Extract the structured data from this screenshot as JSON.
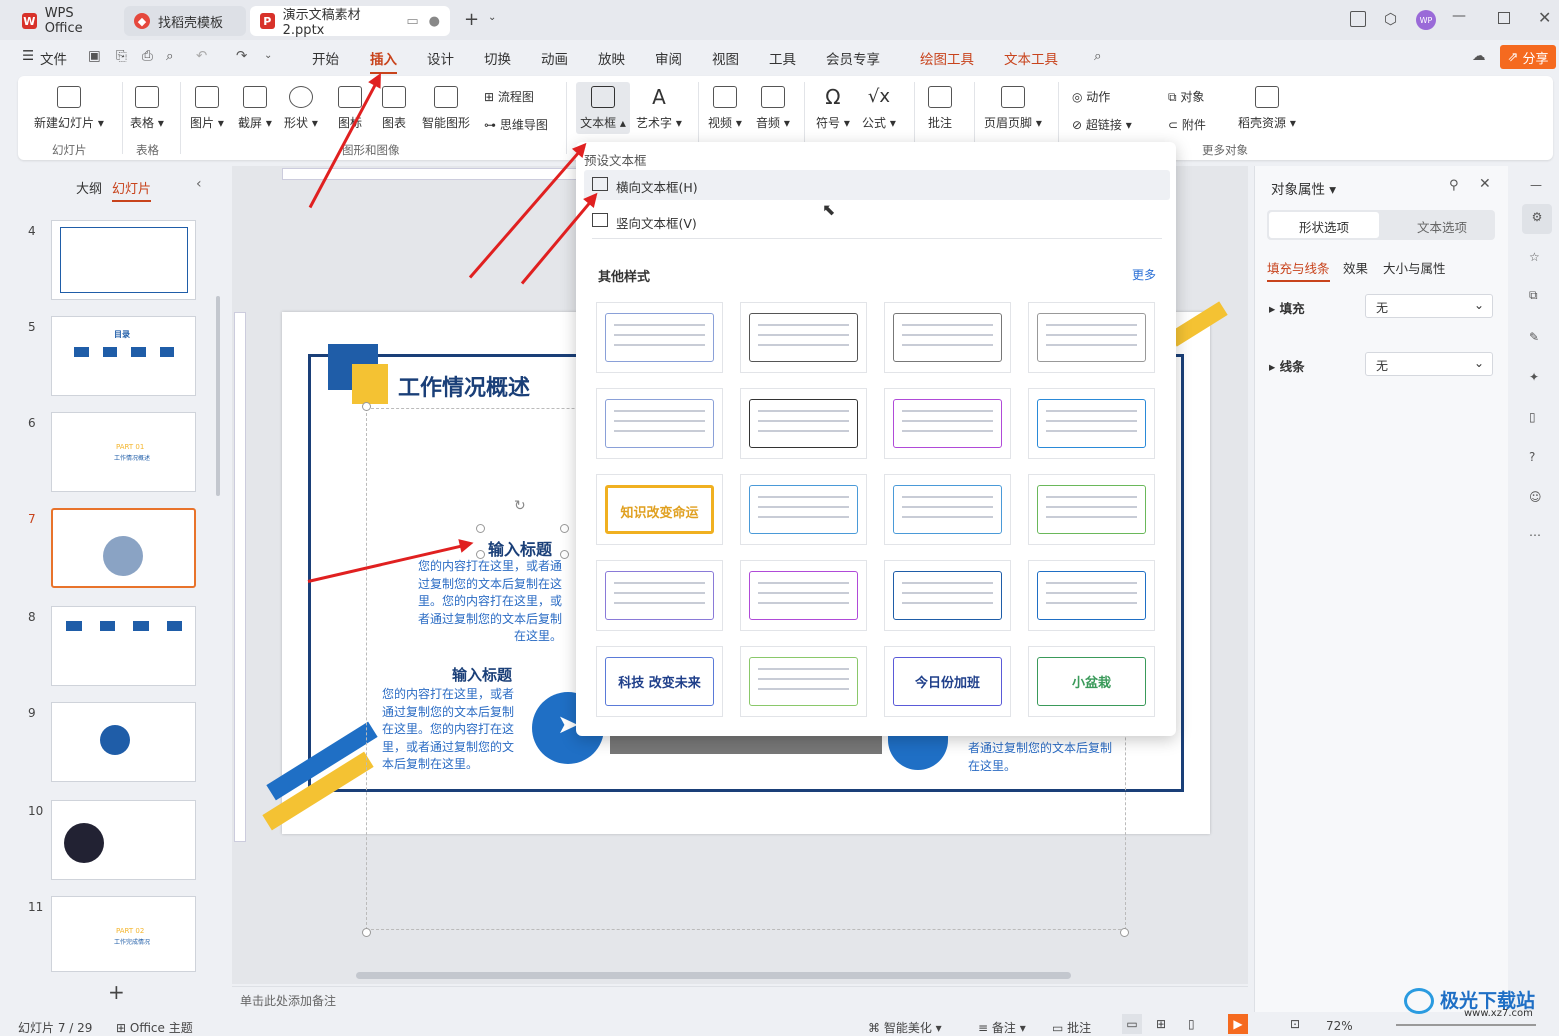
{
  "tabs": [
    {
      "label": "WPS Office"
    },
    {
      "label": "找稻壳模板"
    },
    {
      "label": "演示文稿素材2.pptx"
    }
  ],
  "menu": {
    "file": "文件",
    "items": [
      "开始",
      "插入",
      "设计",
      "切换",
      "动画",
      "放映",
      "审阅",
      "视图",
      "工具",
      "会员专享",
      "绘图工具",
      "文本工具"
    ],
    "share": "分享"
  },
  "ribbon": {
    "new_slide": "新建幻灯片",
    "table": "表格",
    "picture": "图片",
    "screenshot": "截屏",
    "shape": "形状",
    "icons": "图标",
    "chart": "图表",
    "smart": "智能图形",
    "flowchart": "流程图",
    "mindmap": "思维导图",
    "textbox": "文本框",
    "wordart": "艺术字",
    "video": "视频",
    "audio": "音频",
    "symbol": "符号",
    "formula": "公式",
    "comment": "批注",
    "header_footer": "页眉页脚",
    "action": "动作",
    "hyperlink": "超链接",
    "object": "对象",
    "attachment": "附件",
    "docer": "稻壳资源",
    "group_slides": "幻灯片",
    "group_table": "表格",
    "group_graphics": "图形和图像",
    "group_more": "更多对象"
  },
  "left_panel": {
    "outline_tab": "大纲",
    "slides_tab": "幻灯片",
    "slide_numbers": [
      "4",
      "5",
      "6",
      "7",
      "8",
      "9",
      "10",
      "11"
    ],
    "add": "+",
    "thumb_texts": {
      "t5": "目录",
      "t6a": "PART 01",
      "t6b": "工作情况概述",
      "t11a": "PART 02",
      "t11b": "工作完成情况"
    }
  },
  "slide": {
    "title": "工作情况概述",
    "heading1": "输入标题",
    "body1": "您的内容打在这里，或者通过复制您的文本后复制在这里。您的内容打在这里，或者通过复制您的文本后复制在这里。",
    "heading2": "输入标题",
    "body2": "您的内容打在这里，或者通过复制您的文本后复制在这里。您的内容打在这里，或者通过复制您的文本后复制在这里。",
    "body3": "者通过复制您的文本后复制在这里。"
  },
  "dropdown": {
    "preset_title": "预设文本框",
    "horizontal": "横向文本框(H)",
    "vertical": "竖向文本框(V)",
    "other_title": "其他样式",
    "more": "更多",
    "style_texts": [
      "",
      "",
      "",
      "",
      "",
      "",
      "",
      "",
      "",
      "",
      "",
      "",
      "",
      "",
      "",
      "",
      "科技 改变未来",
      "",
      "今日份加班",
      "小盆栽"
    ],
    "style_bold_texts": [
      "",
      "",
      "",
      "",
      "",
      "",
      "",
      "",
      "知识改变命运",
      "",
      "",
      "",
      "",
      "",
      "",
      "",
      "",
      "",
      "",
      ""
    ]
  },
  "right_panel": {
    "title": "对象属性",
    "tab_shape": "形状选项",
    "tab_text": "文本选项",
    "sub_fill": "填充与线条",
    "sub_effect": "效果",
    "sub_size": "大小与属性",
    "fill_label": "填充",
    "fill_value": "无",
    "line_label": "线条",
    "line_value": "无"
  },
  "notes": "单击此处添加备注",
  "status": {
    "slide": "幻灯片 7 / 29",
    "theme": "Office 主题",
    "beautify": "智能美化",
    "notes": "备注",
    "comment": "批注",
    "zoom": "72%"
  },
  "watermark": {
    "brand": "极光下载站",
    "url": "www.xz7.com"
  },
  "colors": {
    "accent": "#c8431c",
    "wps_red": "#d8322a",
    "blue": "#1f5da8",
    "orange": "#f4b52d"
  }
}
